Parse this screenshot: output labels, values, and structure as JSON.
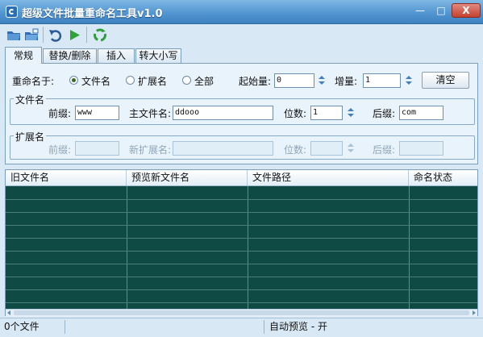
{
  "window": {
    "title": "超级文件批量重命名工具v1.0",
    "min": "—",
    "max": "□",
    "close": "X"
  },
  "tabs": [
    "常规",
    "替换/删除",
    "插入",
    "转大小写"
  ],
  "rename": {
    "label": "重命名于:",
    "options": [
      "文件名",
      "扩展名",
      "全部"
    ],
    "selected": "文件名",
    "start_label": "起始量:",
    "start_value": "0",
    "step_label": "增量:",
    "step_value": "1",
    "clear_label": "清空"
  },
  "filename_group": {
    "title": "文件名",
    "prefix_label": "前缀:",
    "prefix_value": "www",
    "main_label": "主文件名:",
    "main_value": "ddooo",
    "digits_label": "位数:",
    "digits_value": "1",
    "suffix_label": "后缀:",
    "suffix_value": "com"
  },
  "ext_group": {
    "title": "扩展名",
    "prefix_label": "前缀:",
    "new_ext_label": "新扩展名:",
    "digits_label": "位数:",
    "suffix_label": "后缀:"
  },
  "table": {
    "columns": [
      "旧文件名",
      "预览新文件名",
      "文件路径",
      "命名状态"
    ],
    "rows": []
  },
  "status": {
    "files": "0个文件",
    "auto_preview": "自动预览 - 开"
  }
}
